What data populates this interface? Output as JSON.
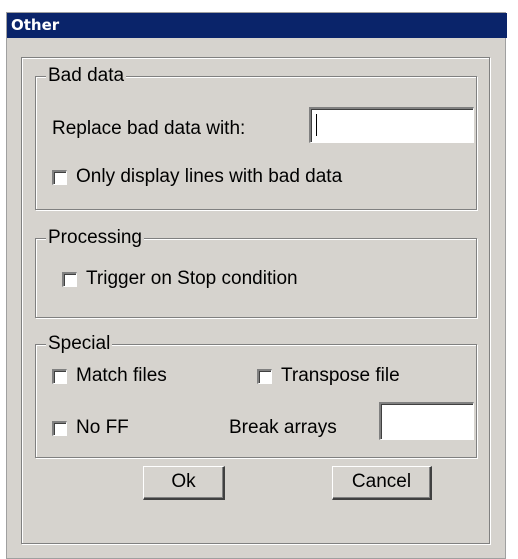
{
  "window": {
    "title": "Other"
  },
  "bad_data": {
    "group_label": "Bad data",
    "replace_label": "Replace bad data with:",
    "replace_value": "",
    "only_display_label": "Only display lines with bad data",
    "only_display_checked": false
  },
  "processing": {
    "group_label": "Processing",
    "trigger_label": "Trigger on Stop condition",
    "trigger_checked": false
  },
  "special": {
    "group_label": "Special",
    "match_files_label": "Match files",
    "match_files_checked": false,
    "transpose_label": "Transpose file",
    "transpose_checked": false,
    "no_ff_label": "No FF",
    "no_ff_checked": false,
    "break_arrays_label": "Break arrays",
    "break_arrays_value": ""
  },
  "buttons": {
    "ok_label": "Ok",
    "cancel_label": "Cancel"
  }
}
